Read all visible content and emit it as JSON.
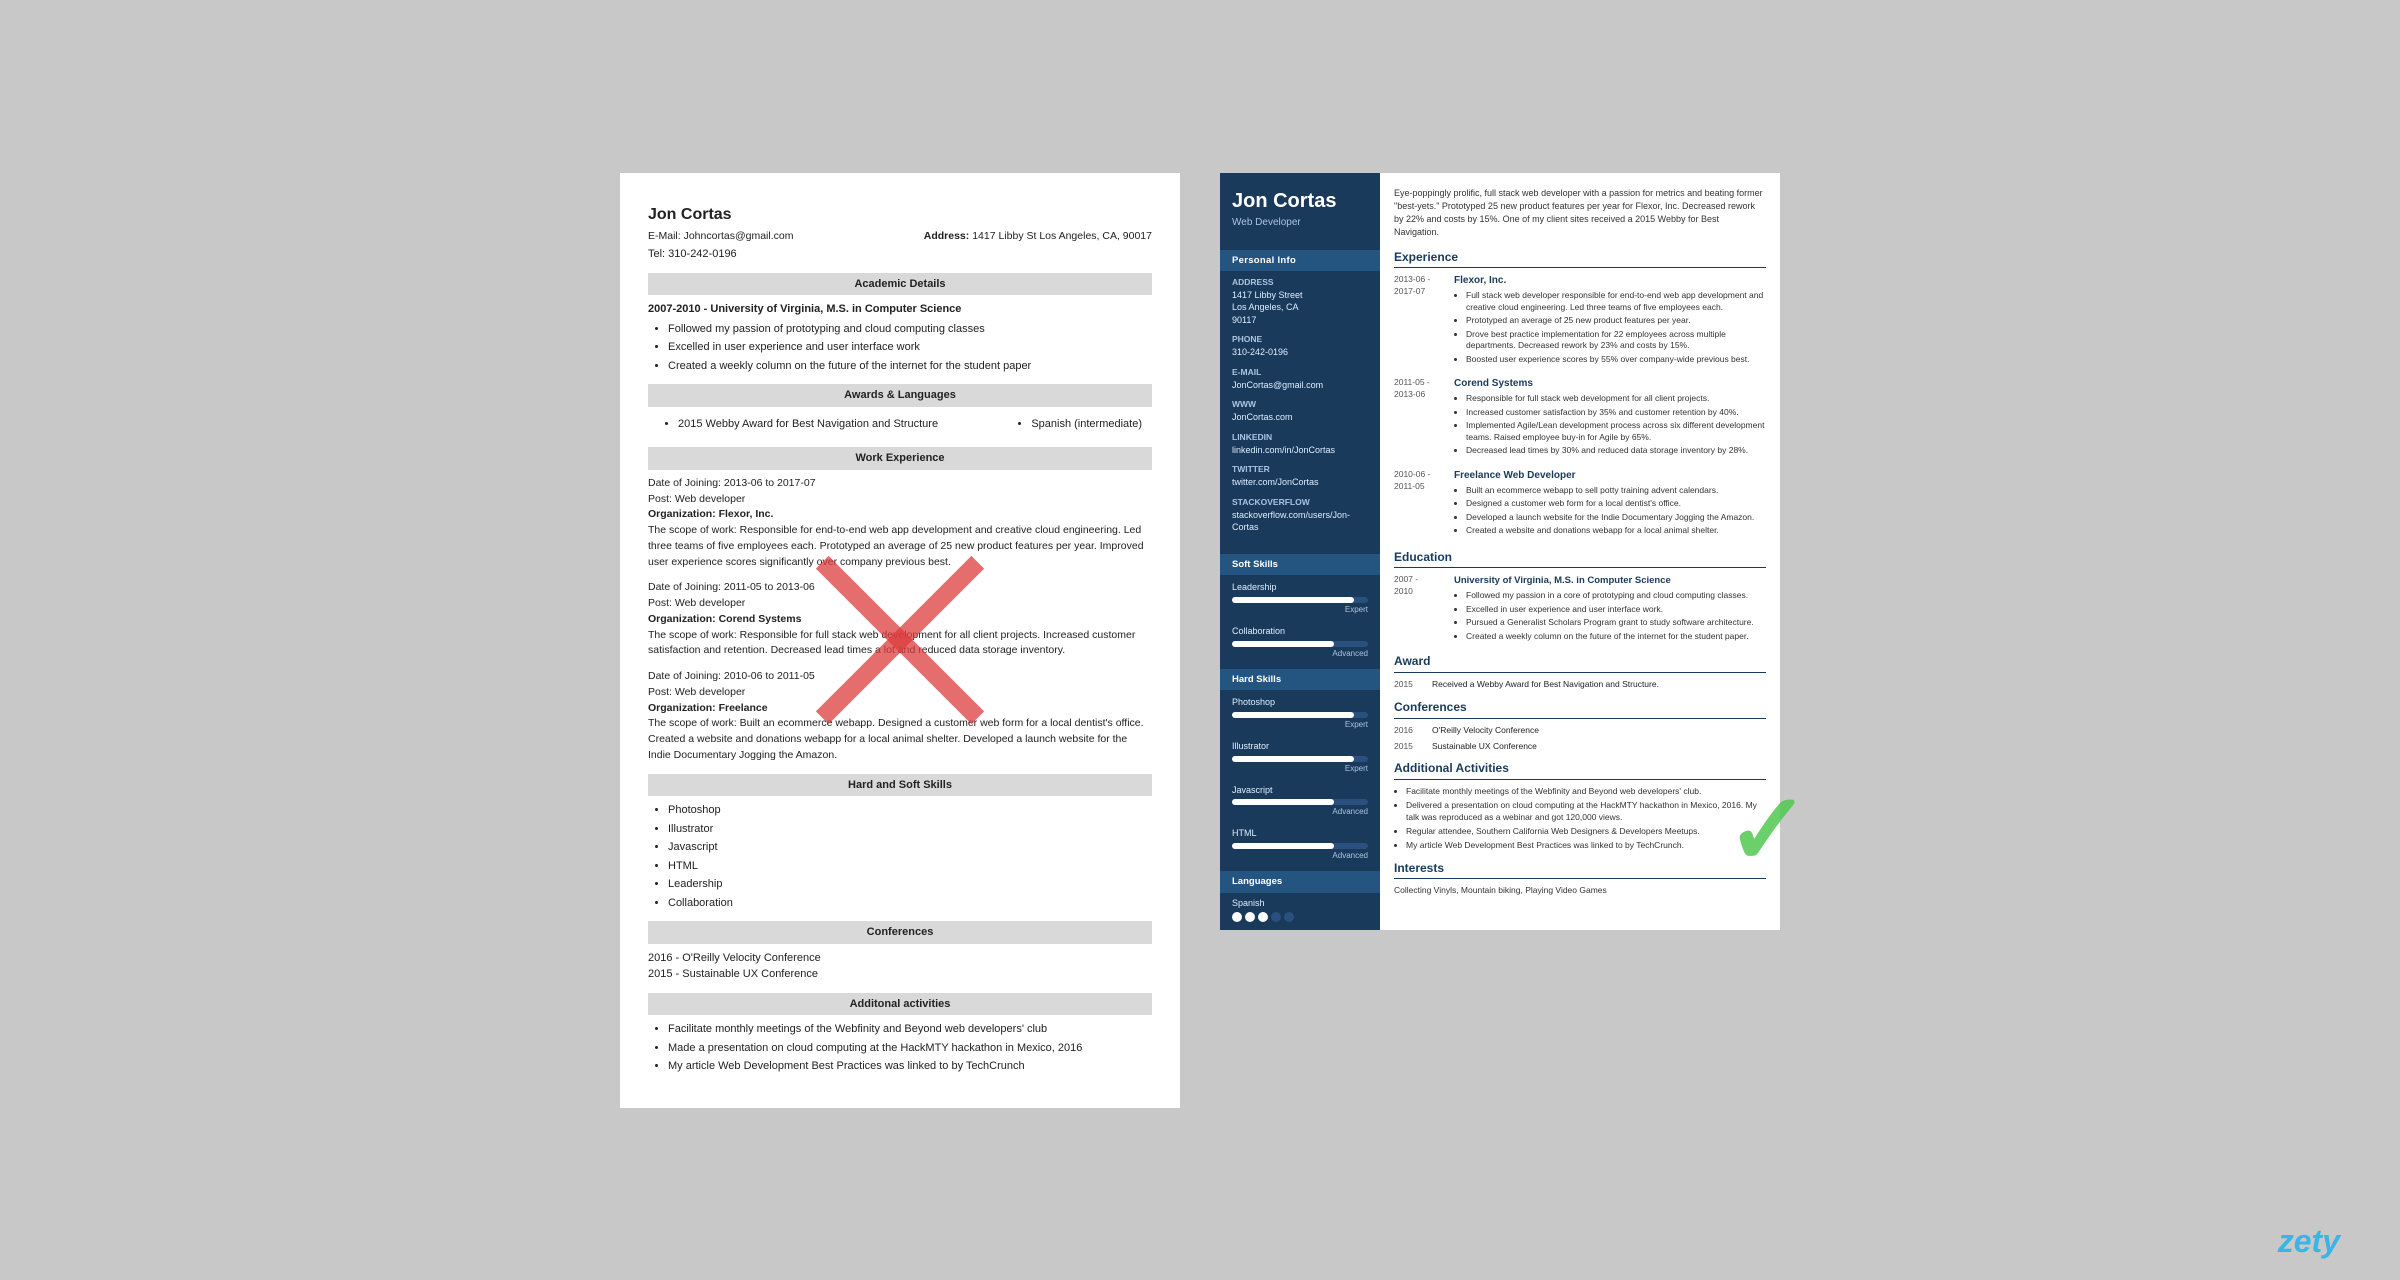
{
  "left_resume": {
    "name": "Jon Cortas",
    "email": "E-Mail: Johncortas@gmail.com",
    "phone": "Tel: 310-242-0196",
    "address_label": "Address:",
    "address": "1417 Libby St Los Angeles, CA, 90017",
    "academic_section": "Academic Details",
    "academic_dates": "2007-2010 - University of Virginia, M.S. in Computer Science",
    "academic_bullets": [
      "Followed my passion of prototyping and cloud computing classes",
      "Excelled in user experience and user interface work",
      "Created a weekly column on the future of the internet for the student paper"
    ],
    "awards_section": "Awards & Languages",
    "award1": "2015 Webby Award for Best Navigation and Structure",
    "award2": "Spanish (intermediate)",
    "work_section": "Work Experience",
    "job1_date": "Date of Joining: 2013-06 to 2017-07",
    "job1_post": "Post: Web developer",
    "job1_org": "Organization: Flexor, Inc.",
    "job1_scope": "The scope of work: Responsible for end-to-end web app development and creative cloud engineering. Led three teams of five employees each. Prototyped an average of 25 new product features per year. Improved user experience scores significantly over company previous best.",
    "job2_date": "Date of Joining: 2011-05 to 2013-06",
    "job2_post": "Post: Web developer",
    "job2_org": "Organization: Corend Systems",
    "job2_scope": "The scope of work: Responsible for full stack web development for all client projects. Increased customer satisfaction and retention. Decreased lead times a lot and reduced data storage inventory.",
    "job3_date": "Date of Joining: 2010-06 to 2011-05",
    "job3_post": "Post: Web developer",
    "job3_org": "Organization: Freelance",
    "job3_scope": "The scope of work: Built an ecommerce webapp. Designed a customer web form for a local dentist's office. Created a website and donations webapp for a local animal shelter. Developed a launch website for the Indie Documentary Jogging the Amazon.",
    "skills_section": "Hard and Soft Skills",
    "skills": [
      "Photoshop",
      "Illustrator",
      "Javascript",
      "HTML",
      "Leadership",
      "Collaboration"
    ],
    "conferences_section": "Conferences",
    "conf1": "2016 - O'Reilly Velocity Conference",
    "conf2": "2015 - Sustainable UX Conference",
    "activities_section": "Additonal activities",
    "activities": [
      "Facilitate monthly meetings of the Webfinity and Beyond web developers' club",
      "Made a presentation on cloud computing at the HackMTY hackathon in Mexico, 2016",
      "My article Web Development Best Practices was linked to by TechCrunch"
    ]
  },
  "right_resume": {
    "name": "Jon Cortas",
    "job_title": "Web Developer",
    "summary": "Eye-poppingly prolific, full stack web developer with a passion for metrics and beating former \"best-yets.\" Prototyped 25 new product features per year for Flexor, Inc. Decreased rework by 22% and costs by 15%. One of my client sites received a 2015 Webby for Best Navigation.",
    "personal_info_label": "Personal Info",
    "address_label": "Address",
    "address": "1417 Libby Street\nLos Angeles, CA\n90117",
    "phone_label": "Phone",
    "phone": "310-242-0196",
    "email_label": "E-mail",
    "email": "JonCortas@gmail.com",
    "www_label": "WWW",
    "www": "JonCortas.com",
    "linkedin_label": "LinkedIn",
    "linkedin": "linkedin.com/in/JonCortas",
    "twitter_label": "Twitter",
    "twitter": "twitter.com/JonCortas",
    "stackoverflow_label": "StackOverflow",
    "stackoverflow": "stackoverflow.com/users/Jon-Cortas",
    "soft_skills_label": "Soft Skills",
    "soft_skills": [
      {
        "name": "Leadership",
        "level": 90,
        "label": "Expert"
      },
      {
        "name": "Collaboration",
        "level": 75,
        "label": "Advanced"
      }
    ],
    "hard_skills_label": "Hard Skills",
    "hard_skills": [
      {
        "name": "Photoshop",
        "level": 90,
        "label": "Expert"
      },
      {
        "name": "Illustrator",
        "level": 90,
        "label": "Expert"
      },
      {
        "name": "Javascript",
        "level": 75,
        "label": "Advanced"
      },
      {
        "name": "HTML",
        "level": 75,
        "label": "Advanced"
      }
    ],
    "languages_label": "Languages",
    "languages": [
      {
        "name": "Spanish",
        "dots": 3,
        "total": 5
      }
    ],
    "experience_label": "Experience",
    "experience": [
      {
        "dates": "2013-06 -\n2017-07",
        "company": "Flexor, Inc.",
        "bullets": [
          "Full stack web developer responsible for end-to-end web app development and creative cloud engineering. Led three teams of five employees each.",
          "Prototyped an average of 25 new product features per year.",
          "Drove best practice implementation for 22 employees across multiple departments. Decreased rework by 23% and costs by 15%.",
          "Boosted user experience scores by 55% over company-wide previous best."
        ]
      },
      {
        "dates": "2011-05 -\n2013-06",
        "company": "Corend Systems",
        "bullets": [
          "Responsible for full stack web development for all client projects.",
          "Increased customer satisfaction by 35% and customer retention by 40%.",
          "Implemented Agile/Lean development process across six different development teams. Raised employee buy-in for Agile by 65%.",
          "Decreased lead times by 30% and reduced data storage inventory by 28%."
        ]
      },
      {
        "dates": "2010-06 -\n2011-05",
        "company": "Freelance Web Developer",
        "bullets": [
          "Built an ecommerce webapp to sell potty training advent calendars.",
          "Designed a customer web form for a local dentist's office.",
          "Developed a launch website for the Indie Documentary Jogging the Amazon.",
          "Created a website and donations webapp for a local animal shelter."
        ]
      }
    ],
    "education_label": "Education",
    "education": [
      {
        "dates": "2007 -\n2010",
        "title": "University of Virginia, M.S. in Computer Science",
        "bullets": [
          "Followed my passion in a core of prototyping and cloud computing classes.",
          "Excelled in user experience and user interface work.",
          "Pursued a Generalist Scholars Program grant to study software architecture.",
          "Created a weekly column on the future of the internet for the student paper."
        ]
      }
    ],
    "award_label": "Award",
    "awards": [
      {
        "year": "2015",
        "text": "Received a Webby Award for Best Navigation and Structure."
      }
    ],
    "conferences_label": "Conferences",
    "conferences": [
      {
        "year": "2016",
        "text": "O'Reilly Velocity Conference"
      },
      {
        "year": "2015",
        "text": "Sustainable UX Conference"
      }
    ],
    "activities_label": "Additional Activities",
    "activities": [
      "Facilitate monthly meetings of the Webfinity and Beyond web developers' club.",
      "Delivered a presentation on cloud computing at the HackMTY hackathon in Mexico, 2016. My talk was reproduced as a webinar and got 120,000 views.",
      "Regular attendee, Southern California Web Designers & Developers Meetups.",
      "My article Web Development Best Practices was linked to by TechCrunch."
    ],
    "interests_label": "Interests",
    "interests": "Collecting Vinyls, Mountain biking, Playing Video Games"
  },
  "zety": "zety"
}
